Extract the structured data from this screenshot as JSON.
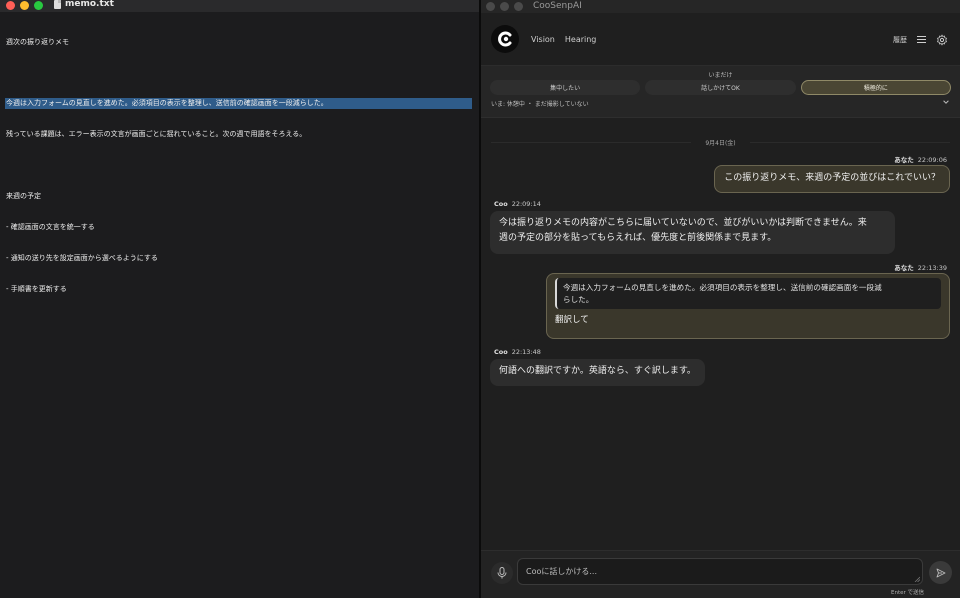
{
  "editor": {
    "file_name": "memo.txt",
    "lines": [
      "週次の振り返りメモ",
      "",
      "今週は入力フォームの見直しを進めた。必須項目の表示を整理し、送信前の確認画面を一段減らした。",
      "残っている課題は、エラー表示の文言が画面ごとに揺れていること。次の週で用語をそろえる。",
      "",
      "来週の予定",
      "- 確認画面の文言を統一する",
      "- 通知の送り先を設定画面から選べるようにする",
      "- 手順書を更新する"
    ],
    "highlighted_line_index": 2
  },
  "app": {
    "window_title": "CooSenpAI",
    "header": {
      "tabs": [
        "Vision",
        "Hearing"
      ],
      "history_label": "履歴"
    },
    "mode": {
      "caption": "いまだけ",
      "options": [
        "集中したい",
        "話しかけてOK",
        "積極的に"
      ],
      "active_index": 2,
      "status": "いま: 休憩中 ・ まだ撮影していない"
    },
    "chat": {
      "date": "9月4日(金)",
      "messages": [
        {
          "sender": "あなた",
          "time": "22:09:06",
          "text": "この振り返りメモ、来週の予定の並びはこれでいい？"
        },
        {
          "sender": "Coo",
          "time": "22:09:14",
          "text_lines": [
            "今は振り返りメモの内容がこちらに届いていないので、並びがいいかは判断できません。来",
            "週の予定の部分を貼ってもらえれば、優先度と前後関係まで見ます。"
          ]
        },
        {
          "sender": "あなた",
          "time": "22:13:39",
          "quote_lines": [
            "今週は入力フォームの見直しを進めた。必須項目の表示を整理し、送信前の確認画面を一段減",
            "らした。"
          ],
          "text": "翻訳して"
        },
        {
          "sender": "Coo",
          "time": "22:13:48",
          "text": "何語への翻訳ですか。英語なら、すぐ訳します。"
        }
      ]
    },
    "input": {
      "placeholder": "Cooに話しかける...",
      "hint": "Enter で送信"
    }
  }
}
